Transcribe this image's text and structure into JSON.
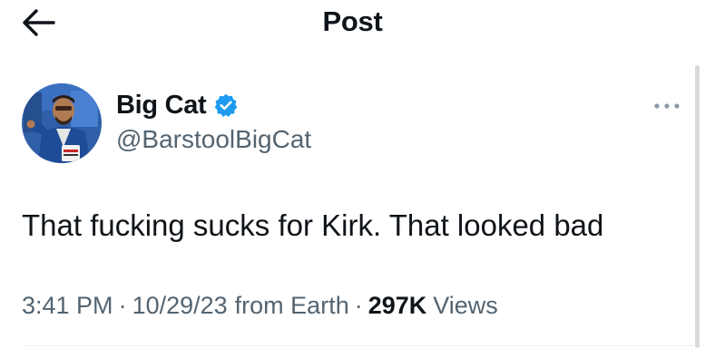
{
  "header": {
    "title": "Post",
    "back_icon": "arrow-left-icon"
  },
  "author": {
    "display_name": "Big Cat",
    "handle": "@BarstoolBigCat",
    "verified": true,
    "verified_color": "#1d9bf0"
  },
  "post": {
    "text": "That fucking sucks for Kirk. That looked bad",
    "time": "3:41 PM",
    "date": "10/29/23",
    "source": "from Earth",
    "separator": "·",
    "views_count": "297K",
    "views_label": "Views"
  },
  "colors": {
    "text_primary": "#0f1419",
    "text_secondary": "#536471",
    "divider": "#eff3f4"
  }
}
